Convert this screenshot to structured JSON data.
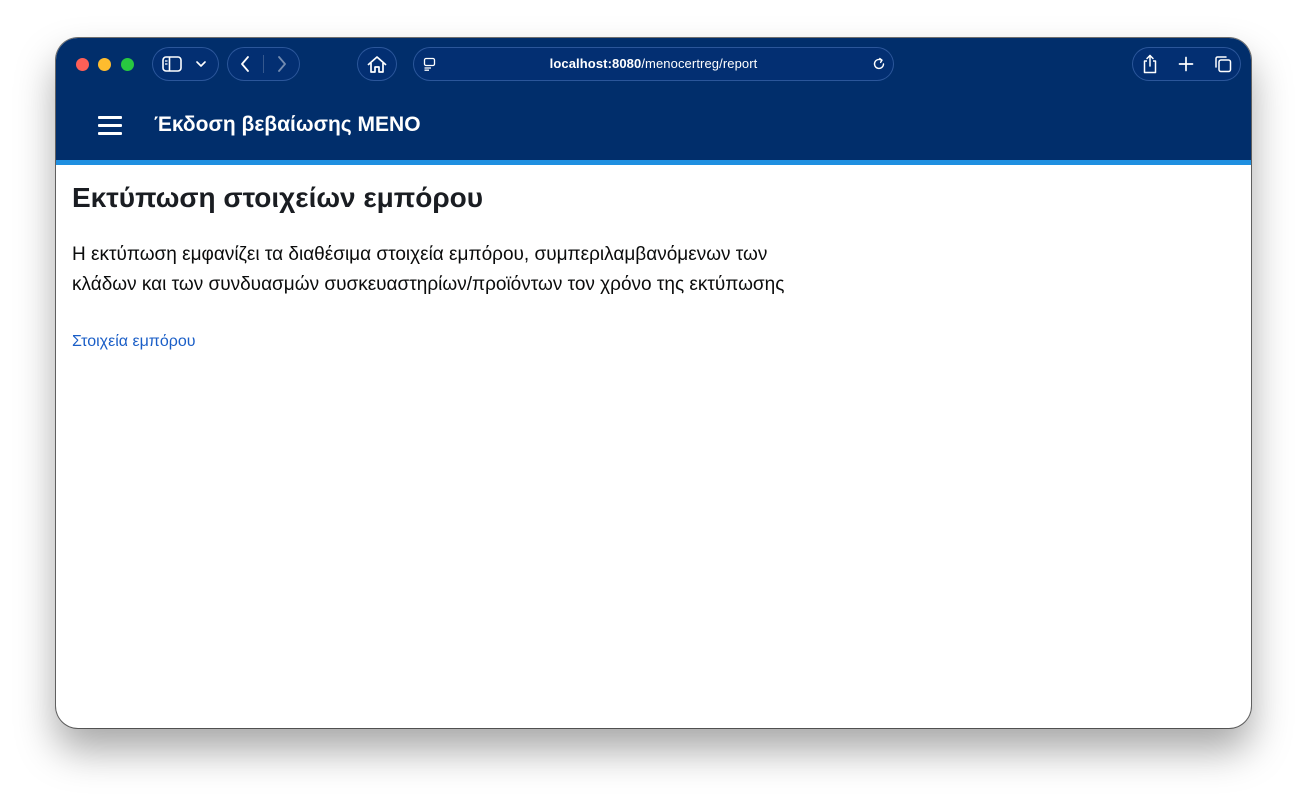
{
  "browser": {
    "url_host": "localhost:8080",
    "url_path": "/menocertreg/report",
    "icons": [
      "sidebar-icon",
      "chevron-down-icon",
      "back-icon",
      "forward-icon",
      "home-icon",
      "page-settings-icon",
      "reload-icon",
      "share-icon",
      "new-tab-icon",
      "tab-overview-icon"
    ]
  },
  "app": {
    "title": "Έκδοση βεβαίωσης ΜΕΝΟ",
    "header_color": "#012e6b",
    "accent_color": "#1f8fe0"
  },
  "main": {
    "heading": "Εκτύπωση στοιχείων εμπόρου",
    "description": "Η εκτύπωση εμφανίζει τα διαθέσιμα στοιχεία εμπόρου, συμπεριλαμβανόμενων των κλάδων και των συνδυασμών συσκευαστηρίων/προϊόντων τον χρόνο της εκτύπωσης",
    "link_label": "Στοιχεία εμπόρου",
    "link_color": "#1a5ec7"
  }
}
